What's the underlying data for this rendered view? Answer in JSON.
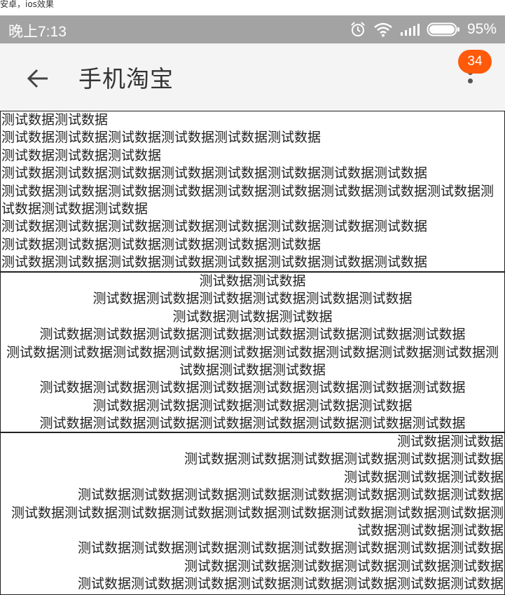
{
  "caption": "安卓，ios效果",
  "status_bar": {
    "time": "晚上7:13",
    "battery_percent": "95%",
    "icons": [
      "alarm-icon",
      "wifi-icon",
      "signal-icon",
      "battery-icon"
    ]
  },
  "toolbar": {
    "title": "手机淘宝",
    "badge_count": "34",
    "badge_color": "#ff5a0a"
  },
  "blocks": [
    {
      "align": "left",
      "lines": [
        "测试数据测试数据",
        "测试数据测试数据测试数据测试数据测试数据测试数据",
        "测试数据测试数据测试数据",
        "测试数据测试数据测试数据测试数据测试数据测试数据测试数据测试数据",
        "测试数据测试数据测试数据测试数据测试数据测试数据测试数据测试数据测试数据测试数据测试数据测试数据",
        "测试数据测试数据测试数据测试数据测试数据测试数据测试数据测试数据",
        "测试数据测试数据测试数据测试数据测试数据测试数据",
        "测试数据测试数据测试数据测试数据测试数据测试数据测试数据测试数据"
      ]
    },
    {
      "align": "center",
      "lines": [
        "测试数据测试数据",
        "测试数据测试数据测试数据测试数据测试数据测试数据",
        "测试数据测试数据测试数据",
        "测试数据测试数据测试数据测试数据测试数据测试数据测试数据测试数据",
        "测试数据测试数据测试数据测试数据测试数据测试数据测试数据测试数据测试数据测试数据测试数据测试数据",
        "测试数据测试数据测试数据测试数据测试数据测试数据测试数据测试数据",
        "测试数据测试数据测试数据测试数据测试数据测试数据",
        "测试数据测试数据测试数据测试数据测试数据测试数据测试数据测试数据"
      ]
    },
    {
      "align": "right",
      "lines": [
        "测试数据测试数据",
        "测试数据测试数据测试数据测试数据测试数据测试数据",
        "测试数据测试数据测试数据",
        "测试数据测试数据测试数据测试数据测试数据测试数据测试数据测试数据",
        "测试数据测试数据测试数据测试数据测试数据测试数据测试数据测试数据测试数据测试数据测试数据测试数据",
        "测试数据测试数据测试数据测试数据测试数据测试数据测试数据测试数据",
        "测试数据测试数据测试数据测试数据测试数据测试数据",
        "测试数据测试数据测试数据测试数据测试数据测试数据测试数据测试数据"
      ]
    }
  ]
}
